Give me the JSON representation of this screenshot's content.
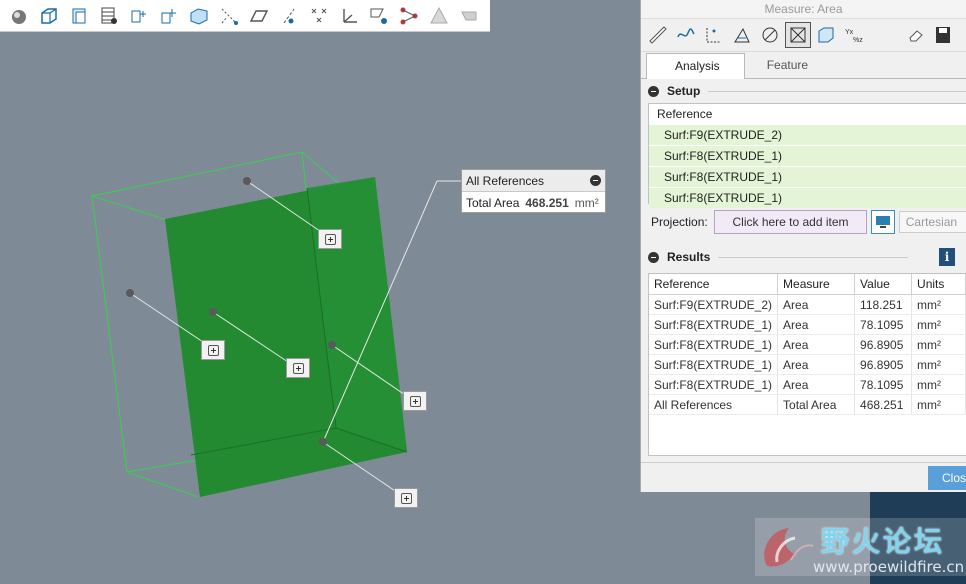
{
  "toolbar": {
    "icons": [
      "appearance-icon",
      "cube-icon",
      "display-style-icon",
      "render-table-icon",
      "saved-views-icon",
      "spin-center-icon",
      "view-manager-icon",
      "perspective-icon",
      "plane-display-icon",
      "axis-display-icon",
      "point-display-icon",
      "csys-display-icon",
      "annotation-display-icon",
      "datum-curve-icon",
      "triangle-icon",
      "flatten-icon"
    ]
  },
  "callout": {
    "title": "All References",
    "label": "Total Area",
    "value": "468.251",
    "unit": "mm²"
  },
  "dialog": {
    "title": "Measure: Area",
    "tools": [
      "length-icon",
      "distance-icon",
      "angle-icon",
      "transform-icon",
      "diameter-icon",
      "area-icon",
      "volume-icon",
      "curvature-icon",
      "eraser-icon",
      "save-icon"
    ],
    "tabs": [
      "Analysis",
      "Feature"
    ],
    "active_tab": "Analysis",
    "setup": {
      "header": "Setup",
      "reference_header": "Reference",
      "references": [
        "Surf:F9(EXTRUDE_2)",
        "Surf:F8(EXTRUDE_1)",
        "Surf:F8(EXTRUDE_1)",
        "Surf:F8(EXTRUDE_1)"
      ],
      "projection_label": "Projection:",
      "projection_placeholder": "Click here to add item",
      "coord_label": "Cartesian"
    },
    "results": {
      "header": "Results",
      "columns": [
        "Reference",
        "Measure",
        "Value",
        "Units"
      ],
      "rows": [
        {
          "ref": "Surf:F9(EXTRUDE_2)",
          "measure": "Area",
          "value": "118.251",
          "unit": "mm²"
        },
        {
          "ref": "Surf:F8(EXTRUDE_1)",
          "measure": "Area",
          "value": "78.1095",
          "unit": "mm²"
        },
        {
          "ref": "Surf:F8(EXTRUDE_1)",
          "measure": "Area",
          "value": "96.8905",
          "unit": "mm²"
        },
        {
          "ref": "Surf:F8(EXTRUDE_1)",
          "measure": "Area",
          "value": "96.8905",
          "unit": "mm²"
        },
        {
          "ref": "Surf:F8(EXTRUDE_1)",
          "measure": "Area",
          "value": "78.1095",
          "unit": "mm²"
        },
        {
          "ref": "All References",
          "measure": "Total Area",
          "value": "468.251",
          "unit": "mm²"
        }
      ]
    },
    "close_label": "Clos"
  },
  "watermark": {
    "cn": "野火论坛",
    "url": "www.proewildfire.cn"
  },
  "colors": {
    "viewport": "#7f8a97",
    "solid_green": "#238a32",
    "selection_green": "#e3f5d6",
    "button_blue": "#5aa0d8"
  }
}
